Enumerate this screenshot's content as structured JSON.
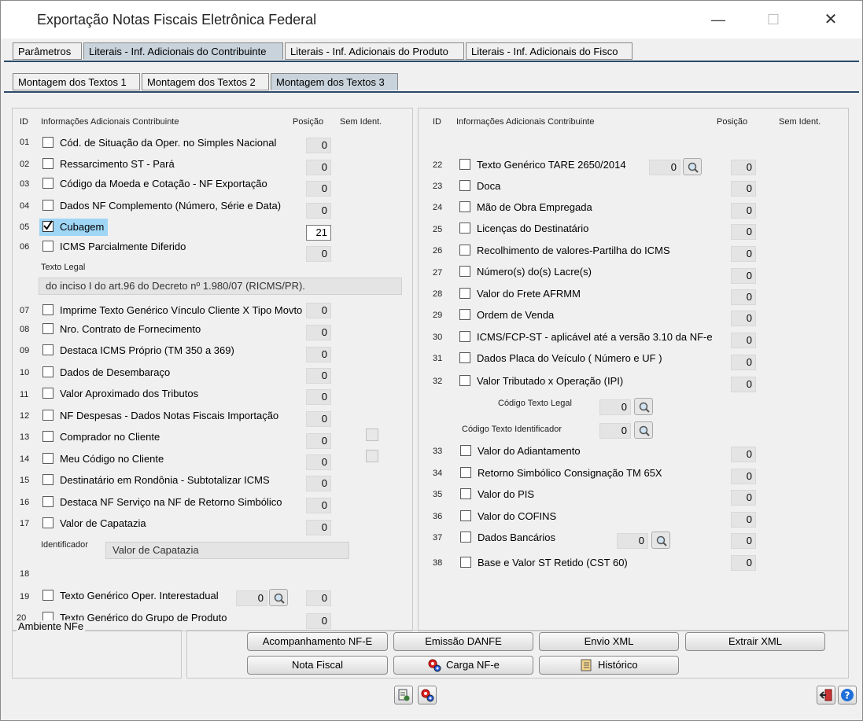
{
  "window": {
    "title": "Exportação Notas Fiscais Eletrônica Federal",
    "controls": {
      "minimize": "—",
      "maximize": "☐",
      "close": "✕"
    }
  },
  "tabs_main": [
    "Parâmetros",
    "Literais - Inf. Adicionais do Contribuinte",
    "Literais - Inf. Adicionais do Produto",
    "Literais - Inf. Adicionais do Fisco"
  ],
  "tabs_sub": [
    "Montagem dos Textos 1",
    "Montagem dos Textos 2",
    "Montagem dos Textos 3"
  ],
  "left": {
    "headers": {
      "id": "ID",
      "info": "Informações Adicionais Contribuinte",
      "pos": "Posição",
      "sem": "Sem Ident."
    },
    "rows": [
      {
        "id": "01",
        "label": "Cód. de Situação da Oper. no Simples Nacional",
        "value": "0",
        "checked": false
      },
      {
        "id": "02",
        "label": "Ressarcimento ST - Pará",
        "value": "0",
        "checked": false
      },
      {
        "id": "03",
        "label": "Código da Moeda e Cotação - NF Exportação",
        "value": "0",
        "checked": false
      },
      {
        "id": "04",
        "label": "Dados NF Complemento (Número, Série e Data)",
        "value": "0",
        "checked": false
      },
      {
        "id": "05",
        "label": "Cubagem",
        "value": "21",
        "checked": true
      },
      {
        "id": "06",
        "label": "ICMS Parcialmente Diferido",
        "value": "0",
        "checked": false
      }
    ],
    "texto_legal_label": "Texto Legal",
    "texto_legal_value": "do inciso I do art.96 do Decreto nº 1.980/07 (RICMS/PR).",
    "rows2": [
      {
        "id": "07",
        "label": "Imprime Texto Genérico Vínculo Cliente X Tipo Movto",
        "value": "0"
      },
      {
        "id": "08",
        "label": "Nro. Contrato de Fornecimento",
        "value": "0"
      },
      {
        "id": "09",
        "label": "Destaca ICMS Próprio  (TM 350 a 369)",
        "value": "0"
      },
      {
        "id": "10",
        "label": "Dados de Desembaraço",
        "value": "0"
      },
      {
        "id": "11",
        "label": "Valor Aproximado dos Tributos",
        "value": "0"
      },
      {
        "id": "12",
        "label": "NF Despesas - Dados Notas Fiscais Importação",
        "value": "0"
      },
      {
        "id": "13",
        "label": "Comprador no Cliente",
        "value": "0"
      },
      {
        "id": "14",
        "label": "Meu Código no Cliente",
        "value": "0"
      },
      {
        "id": "15",
        "label": "Destinatário em Rondônia - Subtotalizar ICMS",
        "value": "0"
      },
      {
        "id": "16",
        "label": "Destaca NF Serviço na NF de Retorno Simbólico",
        "value": "0"
      },
      {
        "id": "17",
        "label": "Valor de Capatazia",
        "value": "0"
      }
    ],
    "identificador_label": "Identificador",
    "identificador_value": "Valor de Capatazia",
    "row18_id": "18",
    "row19": {
      "id": "19",
      "label": "Texto Genérico Oper. Interestadual",
      "code": "0",
      "value": "0"
    },
    "row20": {
      "id": "20",
      "label": "Texto Genérico do Grupo de Produto",
      "value": "0"
    }
  },
  "right": {
    "headers": {
      "id": "ID",
      "info": "Informações Adicionais Contribuinte",
      "pos": "Posição",
      "sem": "Sem Ident."
    },
    "row22": {
      "id": "22",
      "label": "Texto Genérico TARE 2650/2014",
      "code": "0",
      "value": "0"
    },
    "rows": [
      {
        "id": "23",
        "label": "Doca",
        "value": "0"
      },
      {
        "id": "24",
        "label": "Mão de Obra Empregada",
        "value": "0"
      },
      {
        "id": "25",
        "label": "Licenças do Destinatário",
        "value": "0"
      },
      {
        "id": "26",
        "label": "Recolhimento de valores-Partilha do ICMS",
        "value": "0"
      },
      {
        "id": "27",
        "label": "Número(s) do(s) Lacre(s)",
        "value": "0"
      },
      {
        "id": "28",
        "label": "Valor do Frete AFRMM",
        "value": "0"
      },
      {
        "id": "29",
        "label": "Ordem de Venda",
        "value": "0"
      },
      {
        "id": "30",
        "label": "ICMS/FCP-ST - aplicável até a versão 3.10 da NF-e",
        "value": "0"
      },
      {
        "id": "31",
        "label": "Dados Placa do Veículo ( Número e UF )",
        "value": "0"
      },
      {
        "id": "32",
        "label": "Valor Tributado x Operação (IPI)",
        "value": "0"
      }
    ],
    "codigo_texto_legal_label": "Código Texto Legal",
    "codigo_texto_legal_value": "0",
    "codigo_texto_ident_label": "Código Texto Identificador",
    "codigo_texto_ident_value": "0",
    "rows2": [
      {
        "id": "33",
        "label": "Valor do Adiantamento",
        "value": "0"
      },
      {
        "id": "34",
        "label": "Retorno Simbólico Consignação TM 65X",
        "value": "0"
      },
      {
        "id": "35",
        "label": "Valor do PIS",
        "value": "0"
      },
      {
        "id": "36",
        "label": "Valor do COFINS",
        "value": "0"
      }
    ],
    "row37": {
      "id": "37",
      "label": "Dados Bancários",
      "code": "0",
      "value": "0"
    },
    "row38": {
      "id": "38",
      "label": "Base e Valor ST Retido (CST 60)",
      "value": "0"
    }
  },
  "ambiente_label": "Ambiente NFe",
  "buttons": {
    "acompanhamento": "Acompanhamento NF-E",
    "emissao": "Emissão DANFE",
    "envio": "Envio XML",
    "extrair": "Extrair XML",
    "nota_fiscal": "Nota Fiscal",
    "carga": "Carga NF-e",
    "historico": "Histórico"
  },
  "colors": {
    "tab_active": "#c8d3dc",
    "tab_line": "#2c4a6b",
    "highlight": "#9fd6f5"
  }
}
